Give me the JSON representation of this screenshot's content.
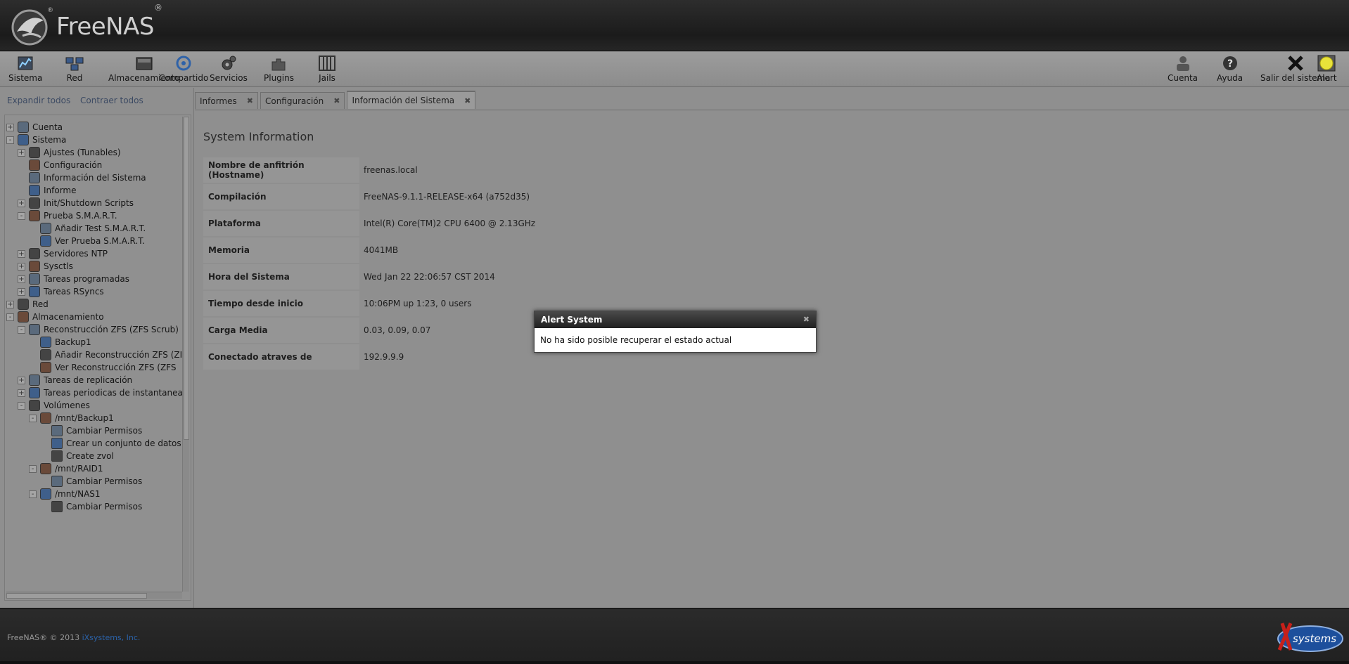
{
  "header": {
    "logo_text": "FreeNAS",
    "logo_reg": "®"
  },
  "toolbar": {
    "left": [
      {
        "label": "Sistema",
        "icon": "system-icon"
      },
      {
        "label": "Red",
        "icon": "network-icon"
      },
      {
        "label": "Almacenamiento",
        "icon": "storage-icon"
      },
      {
        "label": "Compartido",
        "icon": "sharing-icon"
      },
      {
        "label": "Servicios",
        "icon": "services-icon"
      },
      {
        "label": "Plugins",
        "icon": "plugins-icon"
      },
      {
        "label": "Jails",
        "icon": "jails-icon"
      }
    ],
    "right": [
      {
        "label": "Cuenta",
        "icon": "account-icon"
      },
      {
        "label": "Ayuda",
        "icon": "help-icon"
      },
      {
        "label": "Salir del sistema",
        "icon": "logout-icon"
      },
      {
        "label": "Alert",
        "icon": "alert-icon"
      }
    ]
  },
  "tree_controls": {
    "expand": "Expandir todos",
    "collapse": "Contraer todos"
  },
  "tree": [
    {
      "label": "Cuenta",
      "level": 0,
      "toggle": "+"
    },
    {
      "label": "Sistema",
      "level": 0,
      "toggle": "-"
    },
    {
      "label": "Ajustes (Tunables)",
      "level": 1,
      "toggle": "+"
    },
    {
      "label": "Configuración",
      "level": 1,
      "toggle": ""
    },
    {
      "label": "Información del Sistema",
      "level": 1,
      "toggle": ""
    },
    {
      "label": "Informe",
      "level": 1,
      "toggle": ""
    },
    {
      "label": "Init/Shutdown Scripts",
      "level": 1,
      "toggle": "+"
    },
    {
      "label": "Prueba S.M.A.R.T.",
      "level": 1,
      "toggle": "-"
    },
    {
      "label": "Añadir Test S.M.A.R.T.",
      "level": 2,
      "toggle": ""
    },
    {
      "label": "Ver Prueba S.M.A.R.T.",
      "level": 2,
      "toggle": ""
    },
    {
      "label": "Servidores NTP",
      "level": 1,
      "toggle": "+"
    },
    {
      "label": "Sysctls",
      "level": 1,
      "toggle": "+"
    },
    {
      "label": "Tareas programadas",
      "level": 1,
      "toggle": "+"
    },
    {
      "label": "Tareas RSyncs",
      "level": 1,
      "toggle": "+"
    },
    {
      "label": "Red",
      "level": 0,
      "toggle": "+"
    },
    {
      "label": "Almacenamiento",
      "level": 0,
      "toggle": "-"
    },
    {
      "label": "Reconstrucción ZFS (ZFS Scrub)",
      "level": 1,
      "toggle": "-"
    },
    {
      "label": "Backup1",
      "level": 2,
      "toggle": ""
    },
    {
      "label": "Añadir Reconstrucción ZFS (ZI",
      "level": 2,
      "toggle": ""
    },
    {
      "label": "Ver Reconstrucción ZFS (ZFS",
      "level": 2,
      "toggle": ""
    },
    {
      "label": "Tareas de replicación",
      "level": 1,
      "toggle": "+"
    },
    {
      "label": "Tareas periodicas de instantaneas",
      "level": 1,
      "toggle": "+"
    },
    {
      "label": "Volúmenes",
      "level": 1,
      "toggle": "-"
    },
    {
      "label": "/mnt/Backup1",
      "level": 2,
      "toggle": "-"
    },
    {
      "label": "Cambiar Permisos",
      "level": 3,
      "toggle": ""
    },
    {
      "label": "Crear un conjunto de datos",
      "level": 3,
      "toggle": ""
    },
    {
      "label": "Create zvol",
      "level": 3,
      "toggle": ""
    },
    {
      "label": "/mnt/RAID1",
      "level": 2,
      "toggle": "-"
    },
    {
      "label": "Cambiar Permisos",
      "level": 3,
      "toggle": ""
    },
    {
      "label": "/mnt/NAS1",
      "level": 2,
      "toggle": "-"
    },
    {
      "label": "Cambiar Permisos",
      "level": 3,
      "toggle": ""
    }
  ],
  "tabs": [
    {
      "label": "Informes",
      "active": false
    },
    {
      "label": "Configuración",
      "active": false
    },
    {
      "label": "Información del Sistema",
      "active": true
    }
  ],
  "system_info": {
    "title": "System Information",
    "rows": [
      {
        "key": "Nombre de anfitrión (Hostname)",
        "value": "freenas.local"
      },
      {
        "key": "Compilación",
        "value": "FreeNAS-9.1.1-RELEASE-x64 (a752d35)"
      },
      {
        "key": "Plataforma",
        "value": "Intel(R) Core(TM)2 CPU 6400 @ 2.13GHz"
      },
      {
        "key": "Memoria",
        "value": "4041MB"
      },
      {
        "key": "Hora del Sistema",
        "value": "Wed Jan 22 22:06:57 CST 2014"
      },
      {
        "key": "Tiempo desde inicio",
        "value": "10:06PM up 1:23, 0 users"
      },
      {
        "key": "Carga Media",
        "value": "0.03, 0.09, 0.07"
      },
      {
        "key": "Conectado atraves de",
        "value": "192.9.9.9"
      }
    ]
  },
  "alert": {
    "title": "Alert System",
    "message": "No ha sido posible recuperar el estado actual"
  },
  "footer": {
    "text": "FreeNAS® © 2013 ",
    "link": "iXsystems, Inc.",
    "logo_text": "systems"
  }
}
